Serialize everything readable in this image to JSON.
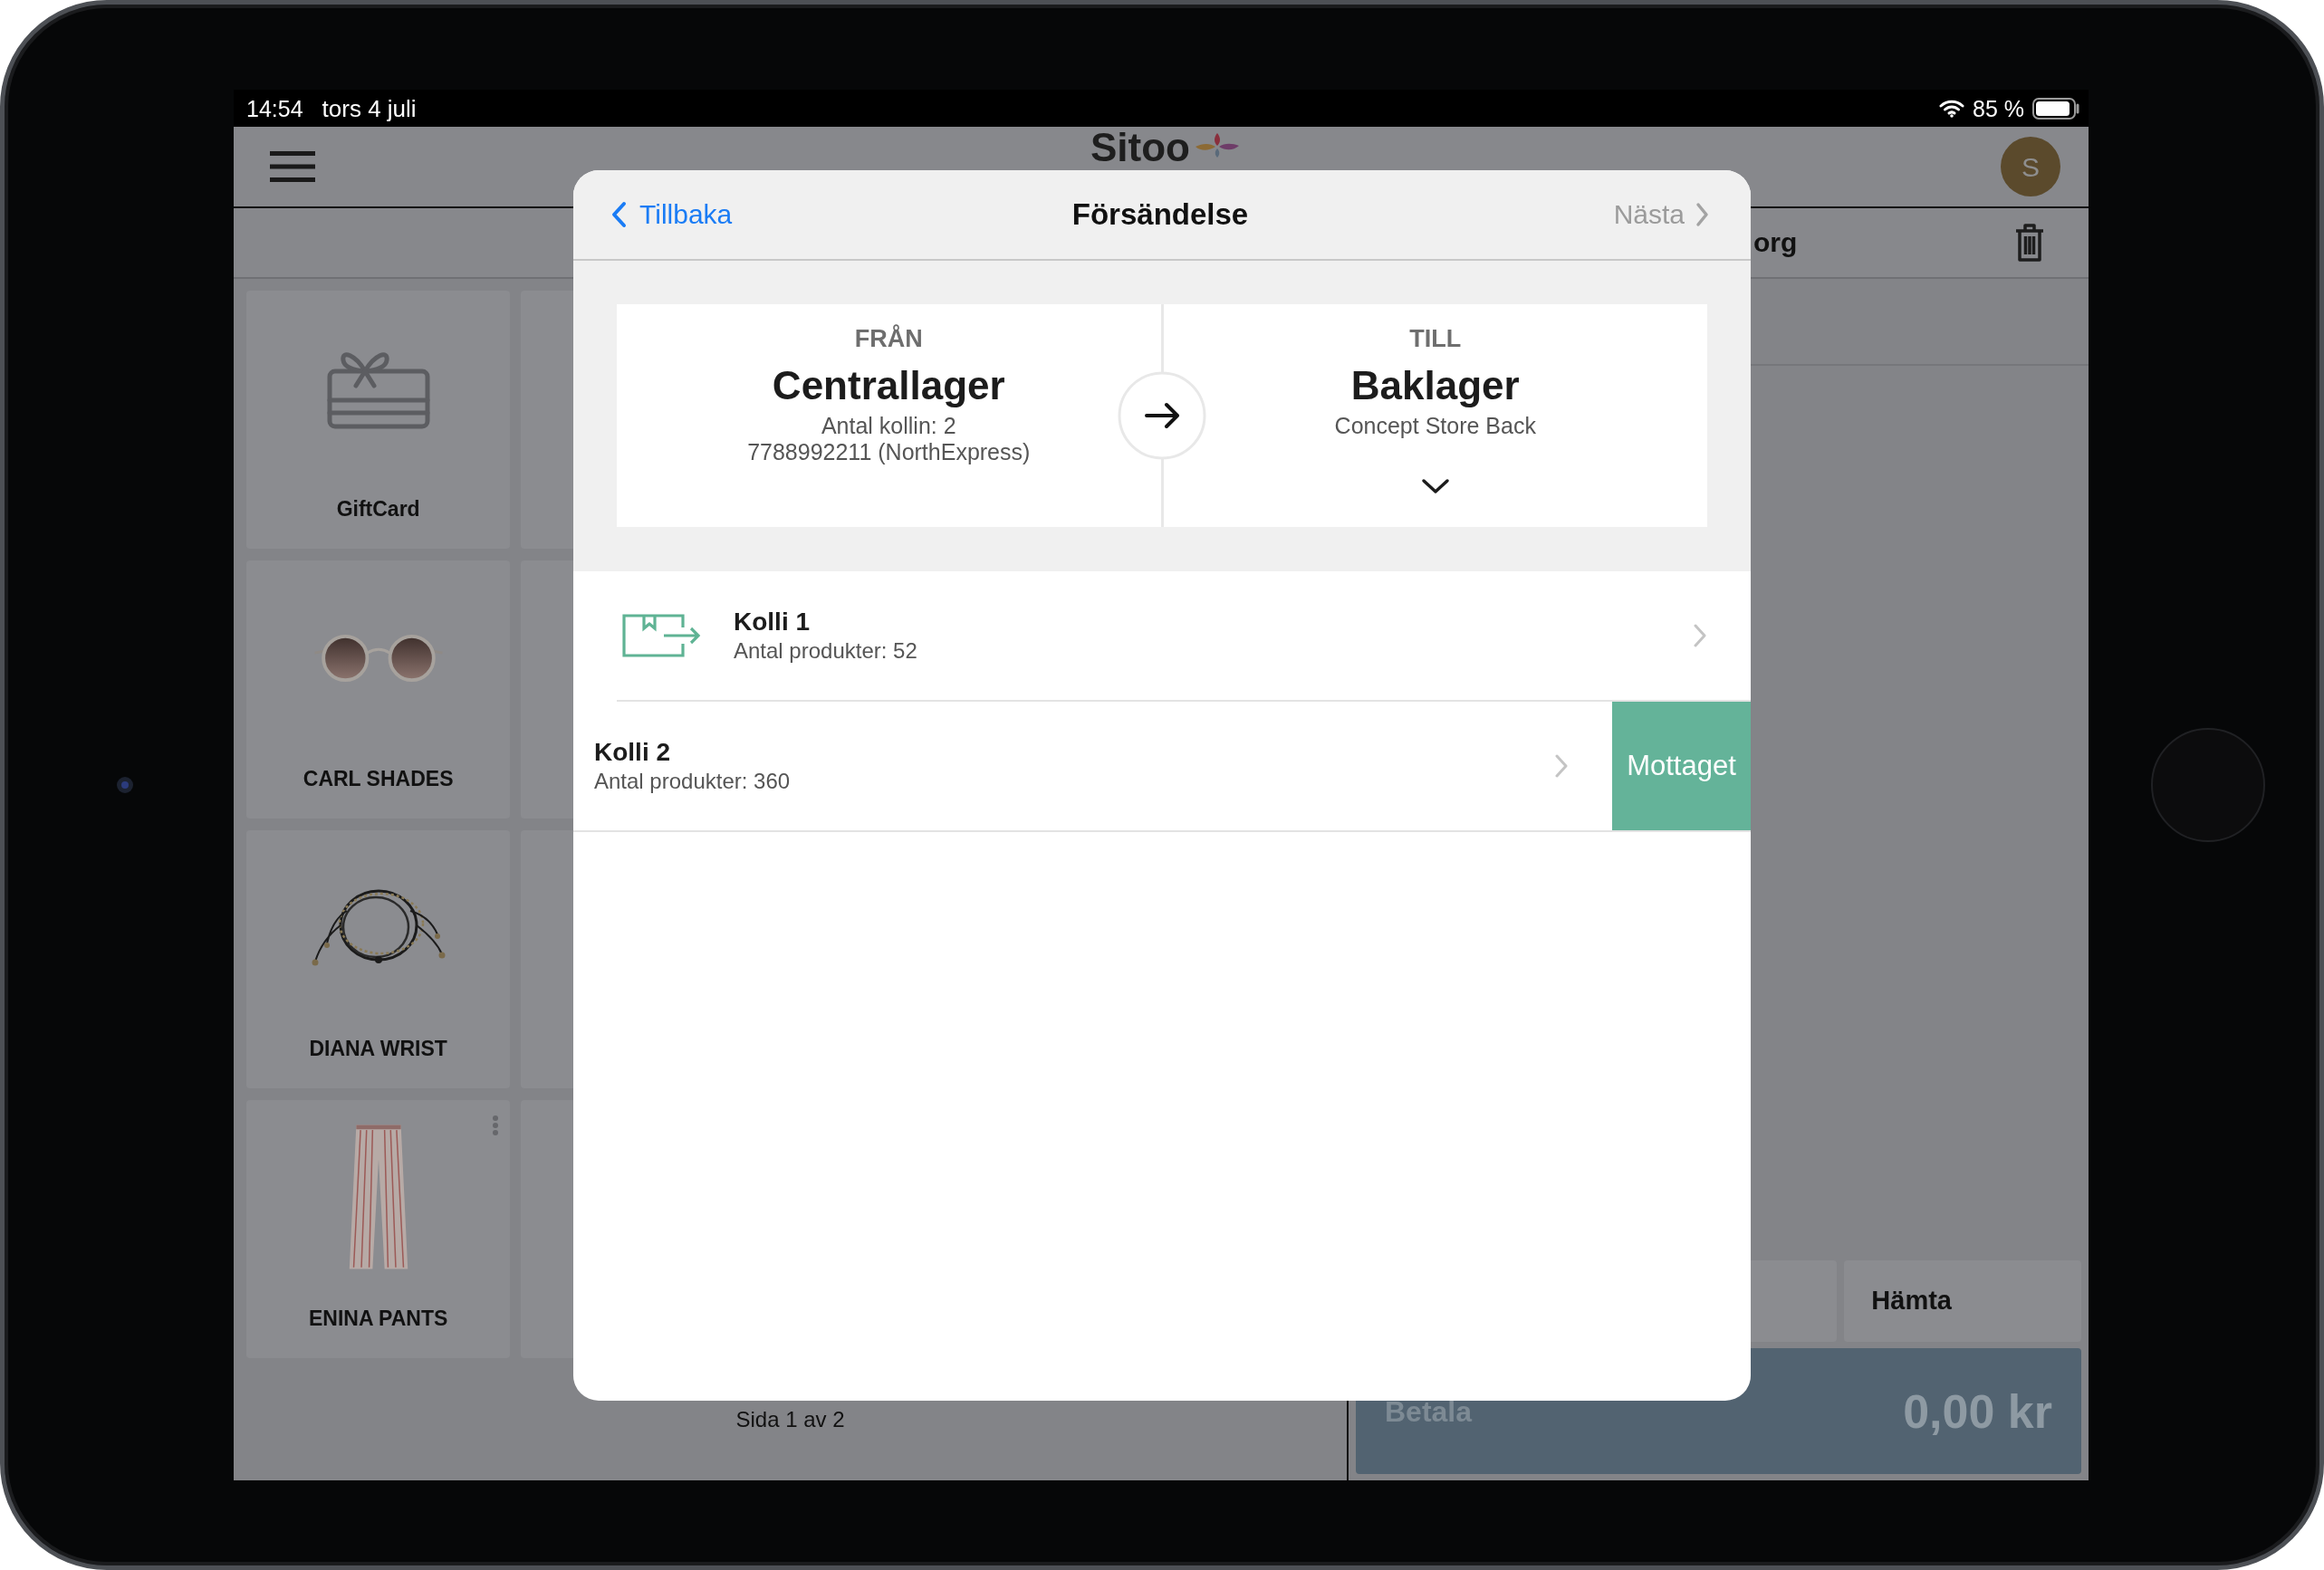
{
  "status_bar": {
    "time": "14:54",
    "date": "tors 4 juli",
    "battery": "85 %"
  },
  "header": {
    "logo": "Sitoo",
    "avatar": "S"
  },
  "products": [
    {
      "name": "GiftCard",
      "kind": "giftcard",
      "has_menu": false
    },
    {
      "name": "CARL SHADES",
      "kind": "sunglasses",
      "has_menu": false
    },
    {
      "name": "DIANA WRIST",
      "kind": "bracelet",
      "has_menu": false
    },
    {
      "name": "ENINA PANTS",
      "kind": "trousers",
      "has_menu": true
    }
  ],
  "pager": "Sida 1 av 2",
  "cart": {
    "title": "org",
    "buttons": [
      "Hämta"
    ],
    "pay": {
      "label": "Betala",
      "total": "0,00 kr"
    }
  },
  "modal": {
    "back": "Tillbaka",
    "title": "Försändelse",
    "next": "Nästa",
    "next_disabled": true,
    "from": {
      "label": "FRÅN",
      "name": "Centrallager",
      "details": [
        "Antal kollin: 2",
        "7788992211 (NorthExpress)"
      ]
    },
    "to": {
      "label": "TILL",
      "name": "Baklager",
      "details": [
        "Concept Store Back"
      ]
    },
    "packages": [
      {
        "title": "Kolli 1",
        "subtitle": "Antal produkter: 52",
        "swiped": false
      },
      {
        "title": "Kolli 2",
        "subtitle": "Antal produkter: 360",
        "swiped": true,
        "action": "Mottaget"
      }
    ]
  }
}
